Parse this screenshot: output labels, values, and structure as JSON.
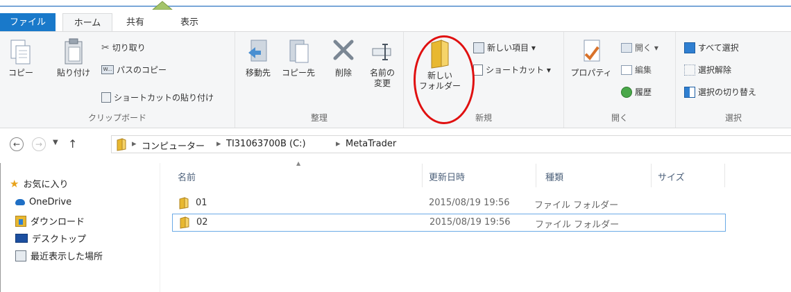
{
  "tabs": {
    "file": "ファイル",
    "home": "ホーム",
    "share": "共有",
    "view": "表示"
  },
  "ribbon": {
    "clipboard": {
      "label": "クリップボード",
      "copy": "コピー",
      "paste": "貼り付け",
      "cut": "切り取り",
      "copy_path": "パスのコピー",
      "paste_shortcut": "ショートカットの貼り付け"
    },
    "organize": {
      "label": "整理",
      "move_to": "移動先",
      "copy_to": "コピー先",
      "delete": "削除",
      "rename_1": "名前の",
      "rename_2": "変更"
    },
    "new": {
      "label": "新規",
      "new_folder_1": "新しい",
      "new_folder_2": "フォルダー",
      "new_item": "新しい項目 ▾",
      "shortcut": "ショートカット ▾"
    },
    "open": {
      "label": "開く",
      "properties": "プロパティ",
      "open": "開く ▾",
      "edit": "編集",
      "history": "履歴"
    },
    "select": {
      "label": "選択",
      "select_all": "すべて選択",
      "select_none": "選択解除",
      "invert": "選択の切り替え"
    }
  },
  "address": {
    "crumbs": [
      "コンピューター",
      "TI31063700B (C:)",
      "MetaTrader"
    ]
  },
  "nav": {
    "favorites": "お気に入り",
    "onedrive": "OneDrive",
    "downloads": "ダウンロード",
    "desktop": "デスクトップ",
    "recent": "最近表示した場所"
  },
  "columns": {
    "name": "名前",
    "modified": "更新日時",
    "type": "種類",
    "size": "サイズ"
  },
  "files": [
    {
      "name": "01",
      "modified": "2015/08/19 19:56",
      "type": "ファイル フォルダー"
    },
    {
      "name": "02",
      "modified": "2015/08/19 19:56",
      "type": "ファイル フォルダー"
    }
  ],
  "colors": {
    "file_tab": "#1979ca",
    "annotation": "#e01010",
    "folder": "#e8b830"
  }
}
